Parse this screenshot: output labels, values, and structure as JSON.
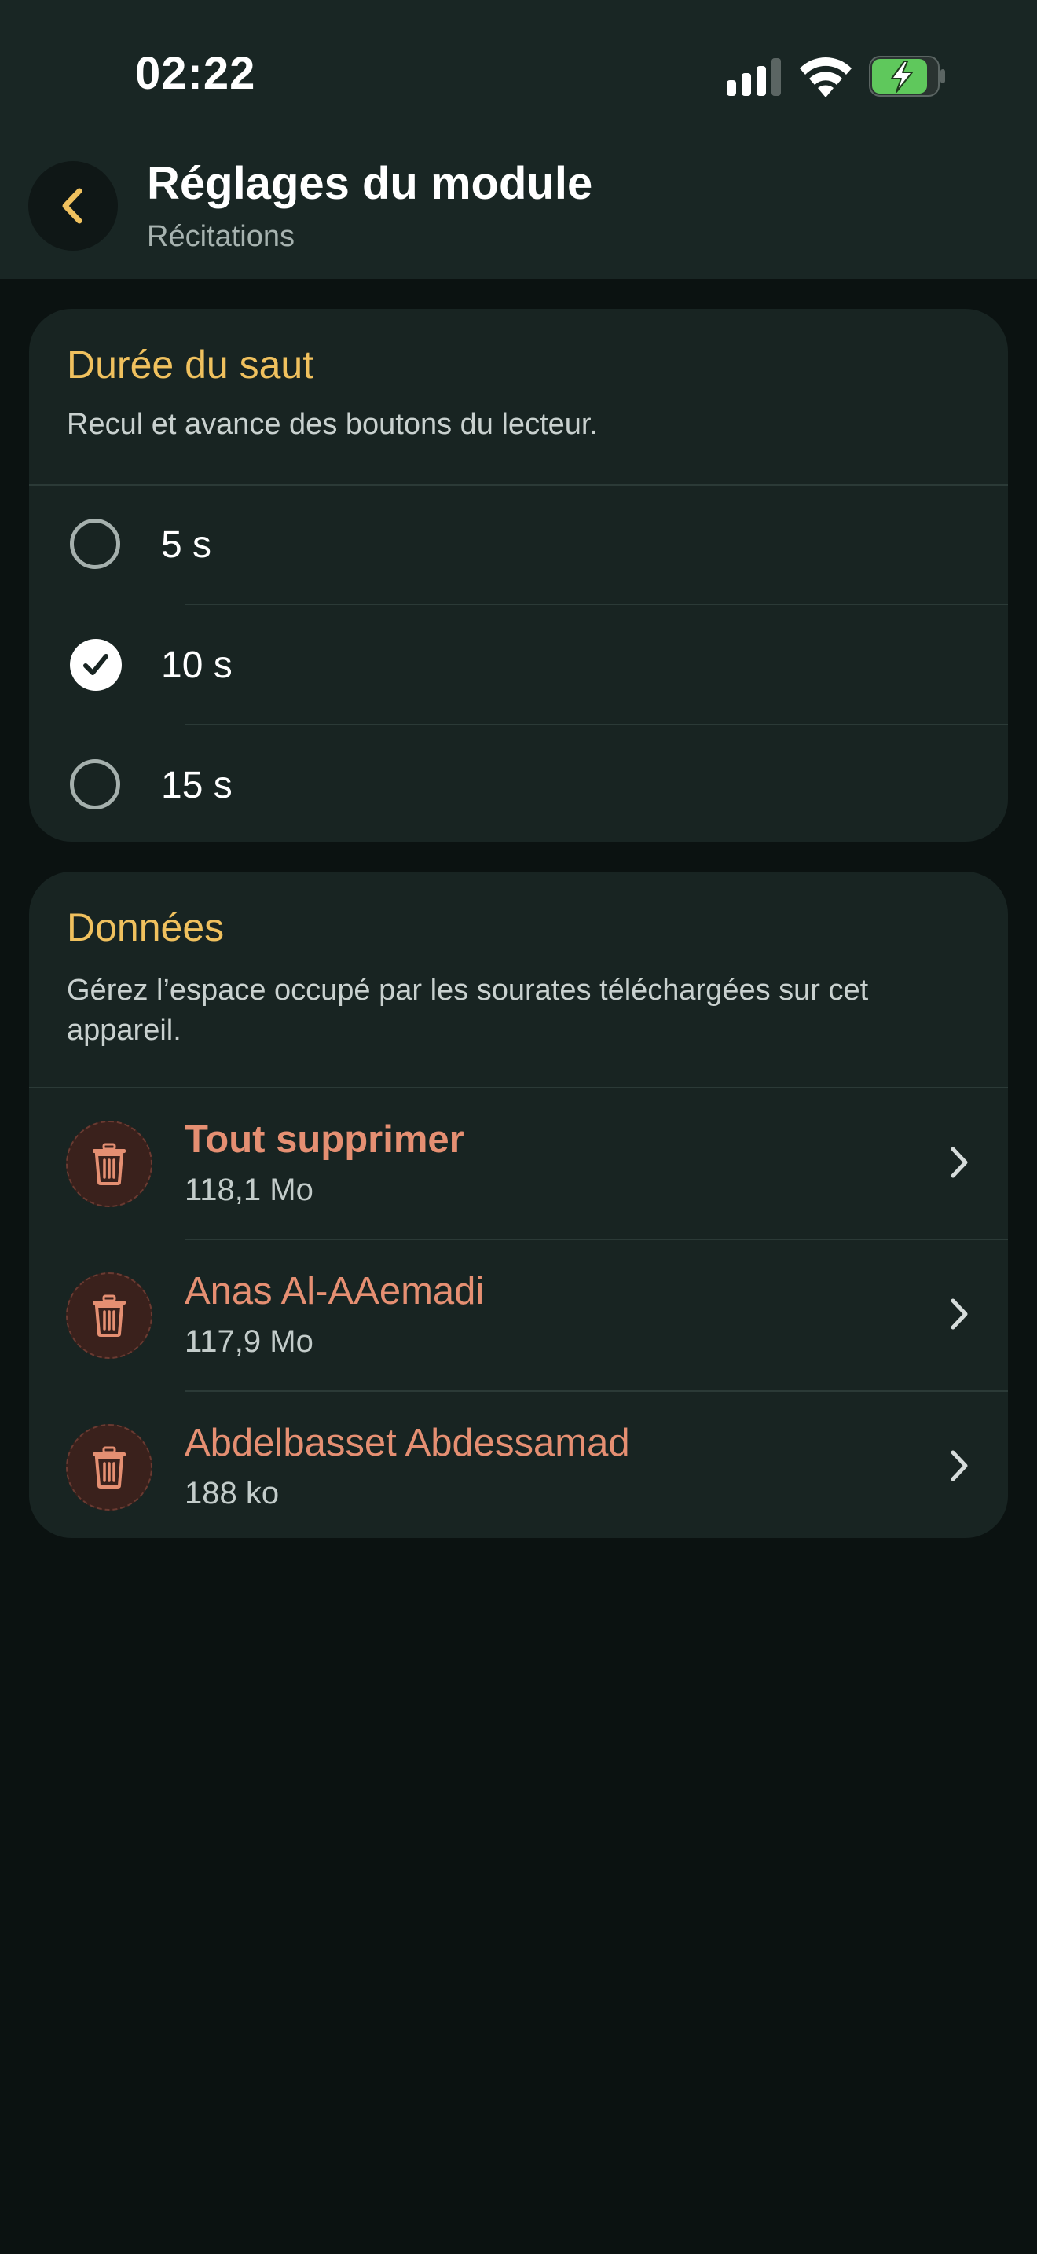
{
  "status_bar": {
    "time": "02:22",
    "signal_icon": "cellular-signal-icon",
    "wifi_icon": "wifi-icon",
    "battery_icon": "battery-charging-icon",
    "battery_color": "#5fc85c"
  },
  "header": {
    "back_icon": "chevron-left-icon",
    "title": "Réglages du module",
    "subtitle": "Récitations",
    "accent_color": "#f0c15e"
  },
  "skip_section": {
    "title": "Durée du saut",
    "description": "Recul et avance des boutons du lecteur.",
    "options": [
      {
        "label": "5 s",
        "selected": false
      },
      {
        "label": "10 s",
        "selected": true
      },
      {
        "label": "15 s",
        "selected": false
      }
    ]
  },
  "data_section": {
    "title": "Données",
    "description": "Gérez l’espace occupé par les sourates téléchargées sur cet appareil.",
    "items": [
      {
        "icon": "trash-icon",
        "title": "Tout supprimer",
        "size": "118,1 Mo"
      },
      {
        "icon": "trash-icon",
        "title": "Anas Al-AAemadi",
        "size": "117,9 Mo"
      },
      {
        "icon": "trash-icon",
        "title": "Abdelbasset Abdessamad",
        "size": "188 ko"
      }
    ],
    "destructive_color": "#e58f72"
  }
}
